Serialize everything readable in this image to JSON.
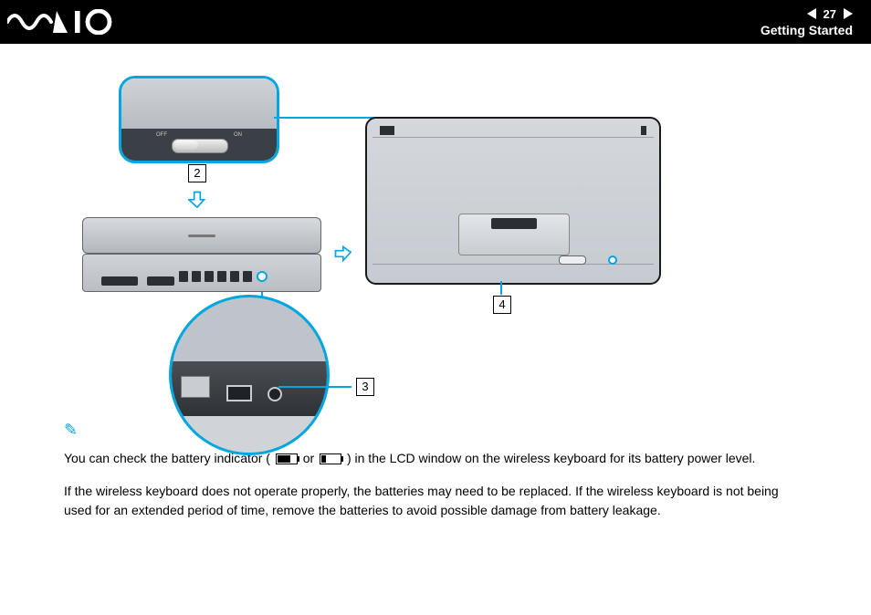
{
  "header": {
    "page_number": "27",
    "section": "Getting Started"
  },
  "diagram": {
    "switch_off": "OFF",
    "switch_on": "ON",
    "callout_2": "2",
    "callout_3": "3",
    "callout_4": "4"
  },
  "body": {
    "note_line_a": "You can check the battery indicator (",
    "note_or": " or ",
    "note_line_b": ") in the LCD window on the wireless keyboard for its battery power level.",
    "paragraph": "If the wireless keyboard does not operate properly, the batteries may need to be replaced. If the wireless keyboard is not being used for an extended period of time, remove the batteries to avoid possible damage from battery leakage."
  }
}
